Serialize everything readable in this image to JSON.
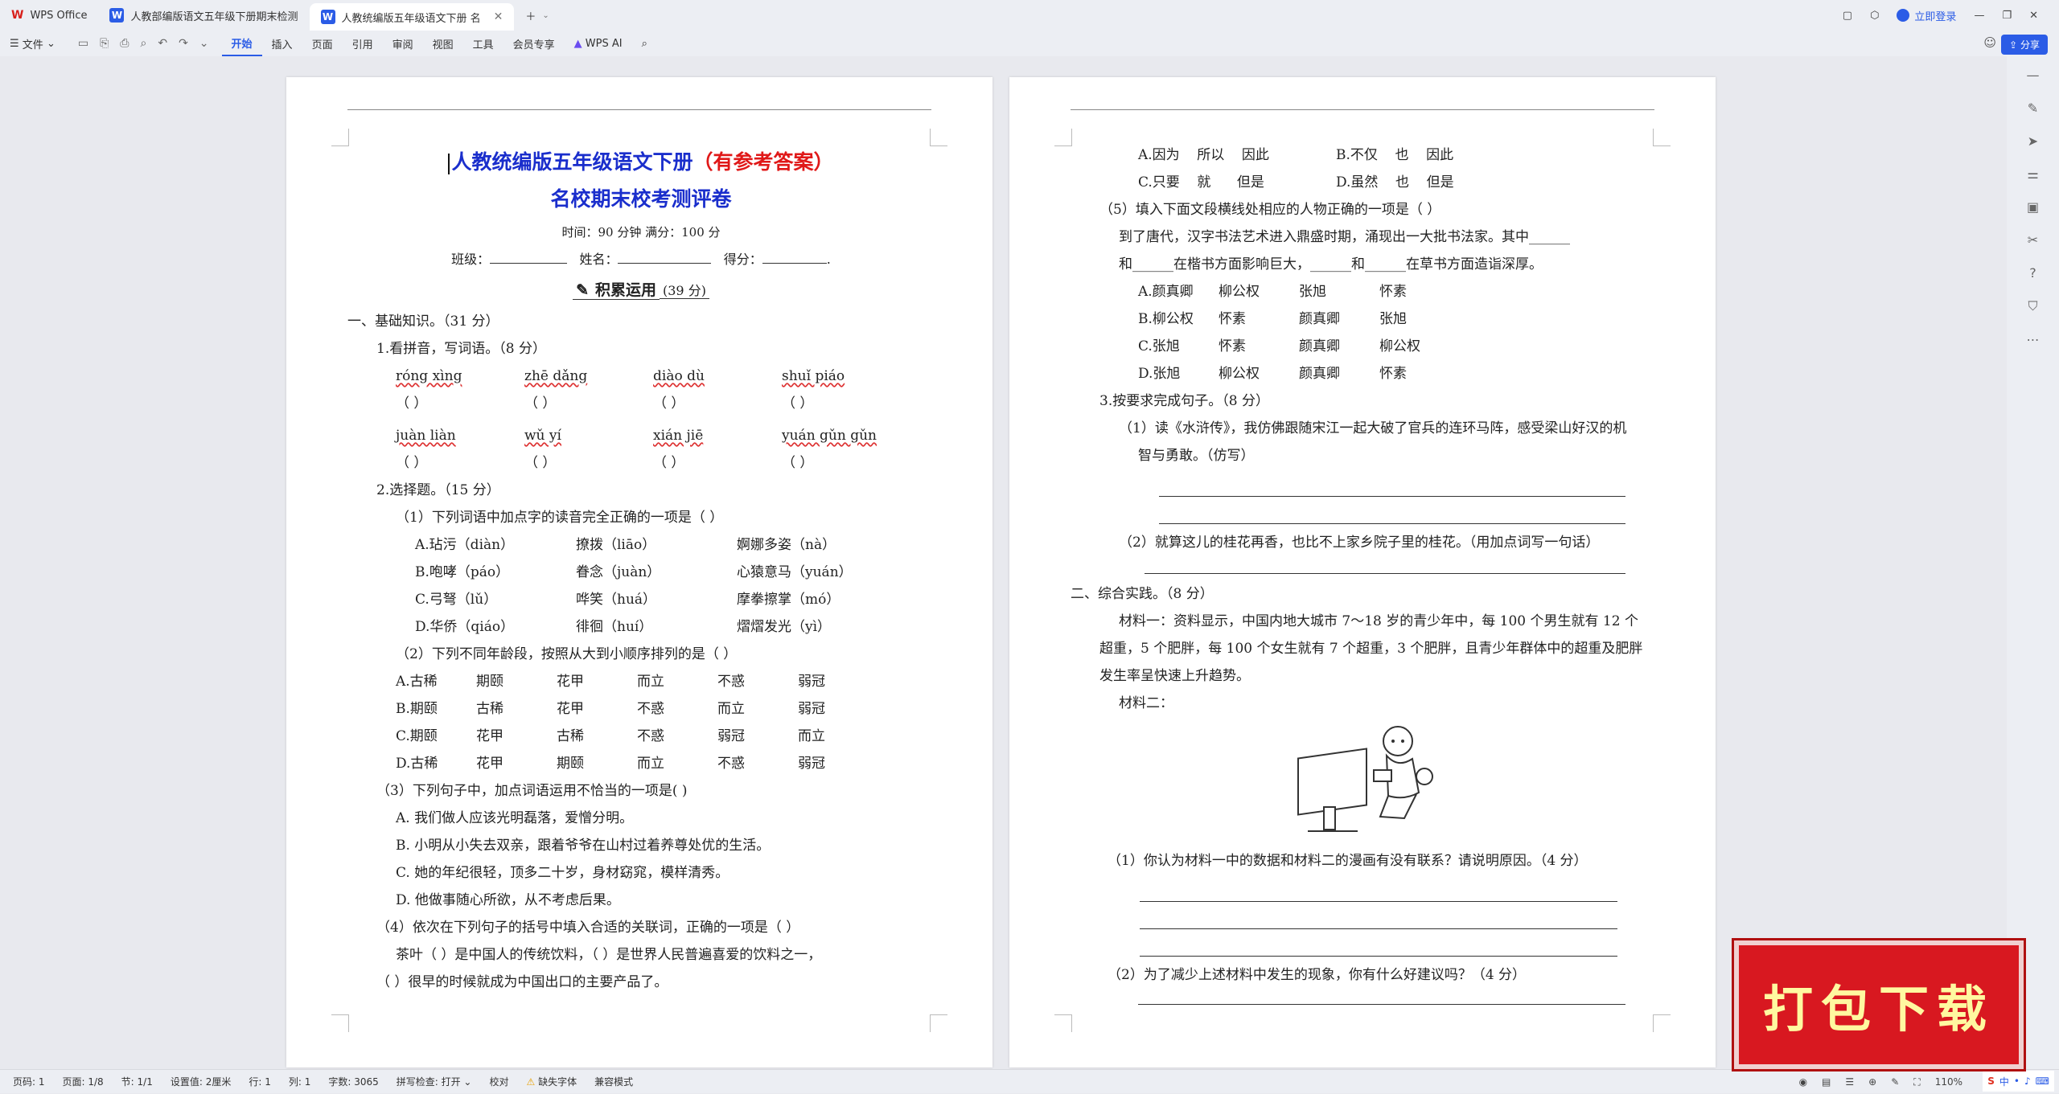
{
  "window": {
    "tabs": [
      {
        "label": "WPS Office"
      },
      {
        "label": "人教部编版语文五年级下册期末检测"
      },
      {
        "label": "人教统编版五年级语文下册 名"
      }
    ],
    "login": "立即登录",
    "share": "分享"
  },
  "ribbon": {
    "file": "文件",
    "tabs": [
      "开始",
      "插入",
      "页面",
      "引用",
      "审阅",
      "视图",
      "工具",
      "会员专享"
    ],
    "ai": "WPS AI"
  },
  "page1": {
    "title_main": "人教统编版五年级语文下册",
    "title_red": "（有参考答案）",
    "subtitle": "名校期末校考测评卷",
    "time_line": "时间：90 分钟  满分：100 分",
    "fields": {
      "class": "班级：",
      "name": "姓名：",
      "score": "得分："
    },
    "section": "积累运用",
    "section_score": "(39 分)",
    "part1": "一、基础知识。（31 分）",
    "q1": "1.看拼音，写词语。（8 分）",
    "pinyin_row1": [
      "róng xìng",
      "zhē dǎng",
      "diào dù",
      "shuǐ piáo"
    ],
    "pinyin_row2": [
      "juàn liàn",
      "wǔ yí",
      "xián jiē",
      "yuán gǔn gǔn"
    ],
    "paren": "（        ）",
    "q2": "2.选择题。（15 分）",
    "q2_1": "（1）下列词语中加点字的读音完全正确的一项是（    ）",
    "q2_1_opts": [
      [
        "A.玷污（diàn）",
        "撩拨（liāo）",
        "婀娜多姿（nà）"
      ],
      [
        "B.咆哮（páo）",
        "眷念（juàn）",
        "心猿意马（yuán）"
      ],
      [
        "C.弓弩（lǔ）",
        "哗笑（huá）",
        "摩拳擦掌（mó）"
      ],
      [
        "D.华侨（qiáo）",
        "徘徊（huí）",
        "熠熠发光（yì）"
      ]
    ],
    "q2_2": "（2）下列不同年龄段，按照从大到小顺序排列的是（    ）",
    "q2_2_opts": [
      [
        "A.古稀",
        "期颐",
        "花甲",
        "而立",
        "不惑",
        "弱冠"
      ],
      [
        "B.期颐",
        "古稀",
        "花甲",
        "不惑",
        "而立",
        "弱冠"
      ],
      [
        "C.期颐",
        "花甲",
        "古稀",
        "不惑",
        "弱冠",
        "而立"
      ],
      [
        "D.古稀",
        "花甲",
        "期颐",
        "而立",
        "不惑",
        "弱冠"
      ]
    ],
    "q2_3": "（3）下列句子中，加点词语运用不恰当的一项是(    )",
    "q2_3_opts": [
      "A.  我们做人应该光明磊落，爱憎分明。",
      "B.  小明从小失去双亲，跟着爷爷在山村过着养尊处优的生活。",
      "C.  她的年纪很轻，顶多二十岁，身材窈窕，模样清秀。",
      "D.  他做事随心所欲，从不考虑后果。"
    ],
    "q2_4": "（4）依次在下列句子的括号中填入合适的关联词，正确的一项是（    ）",
    "q2_4_l1": "茶叶（         ）是中国人的传统饮料，（         ）是世界人民普遍喜爱的饮料之一，",
    "q2_4_l2": "（         ）很早的时候就成为中国出口的主要产品了。"
  },
  "page2": {
    "opts_top": [
      [
        "A.因为    所以    因此",
        "B.不仅    也    因此"
      ],
      [
        "C.只要    就      但是",
        "D.虽然    也    但是"
      ]
    ],
    "q5": "（5）填入下面文段横线处相应的人物正确的一项是（      ）",
    "q5_p1": "到了唐代，汉字书法艺术进入鼎盛时期，涌现出一大批书法家。其中______",
    "q5_p2": "和______在楷书方面影响巨大，______和______在草书方面造诣深厚。",
    "q5_opts": [
      [
        "A.颜真卿",
        "柳公权",
        "张旭",
        "怀素"
      ],
      [
        "B.柳公权",
        "怀素",
        "颜真卿",
        "张旭"
      ],
      [
        "C.张旭",
        "怀素",
        "颜真卿",
        "柳公权"
      ],
      [
        "D.张旭",
        "柳公权",
        "颜真卿",
        "怀素"
      ]
    ],
    "q3": "3.按要求完成句子。（8 分）",
    "q3_1a": "（1）读《水浒传》，我仿佛跟随宋江一起大破了官兵的连环马阵，感受梁山好汉的机",
    "q3_1b": "智与勇敢。（仿写）",
    "q3_2": "（2）就算这儿的桂花再香，也比不上家乡院子里的桂花。（用加点词写一句话）",
    "part2": "二、综合实践。（8 分）",
    "m1a": "材料一：资料显示，中国内地大城市 7～18 岁的青少年中，每 100 个男生就有 12 个",
    "m1b": "超重，5 个肥胖，每 100 个女生就有 7 个超重，3 个肥胖，且青少年群体中的超重及肥胖",
    "m1c": "发生率呈快速上升趋势。",
    "m2": "材料二：",
    "p_q1": "（1）你认为材料一中的数据和材料二的漫画有没有联系？请说明原因。（4 分）",
    "p_q2": "（2）为了减少上述材料中发生的现象，你有什么好建议吗？（4 分）"
  },
  "status": {
    "page": "页码: 1",
    "pages": "页面: 1/8",
    "section": "节: 1/1",
    "setting": "设置值: 2厘米",
    "line": "行: 1",
    "col": "列: 1",
    "words": "字数: 3065",
    "spell": "拼写检查: 打开",
    "proof": "校对",
    "font_missing": "缺失字体",
    "compat": "兼容模式",
    "zoom": "110%"
  },
  "banner": "打包下载"
}
